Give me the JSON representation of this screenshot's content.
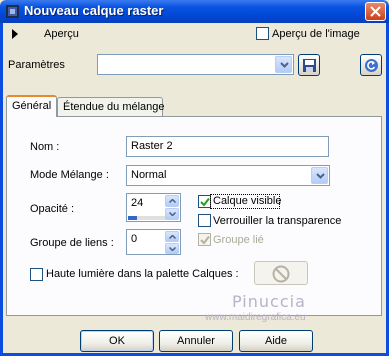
{
  "window": {
    "title": "Nouveau calque raster"
  },
  "preview": {
    "label": "Aperçu",
    "preview_image_label": "Aperçu de l'image",
    "preview_image_checked": false
  },
  "params": {
    "label": "Paramètres",
    "preset_value": ""
  },
  "tabs": [
    {
      "label": "Général",
      "active": true
    },
    {
      "label": "Étendue du mélange",
      "active": false
    }
  ],
  "general": {
    "name_label": "Nom :",
    "name_value": "Raster 2",
    "blend_label": "Mode Mélange :",
    "blend_value": "Normal",
    "opacity_label": "Opacité :",
    "opacity_value": "24",
    "opacity_max": "100",
    "link_label": "Groupe de liens :",
    "link_value": "0",
    "visible_label": "Calque visible",
    "visible_checked": true,
    "lock_label": "Verrouiller la transparence",
    "lock_checked": false,
    "group_label": "Groupe lié",
    "group_checked": true,
    "highlight_label": "Haute lumière dans la palette Calques :",
    "highlight_checked": false
  },
  "watermark": {
    "name": "Pinuccia",
    "url": "www.maidiregrafica.eu"
  },
  "buttons": {
    "ok": "OK",
    "cancel": "Annuler",
    "help": "Aide"
  },
  "colors": {
    "titlebar": "#0a54e0",
    "face": "#ece9d8",
    "accent": "#e68b2c"
  }
}
